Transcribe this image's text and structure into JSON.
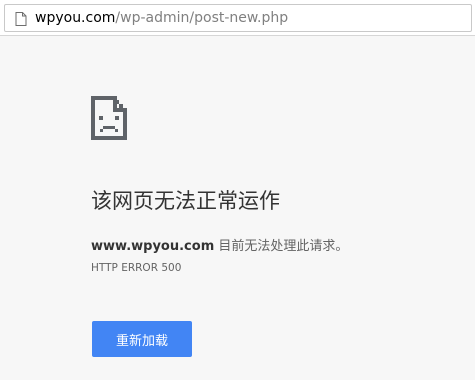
{
  "address_bar": {
    "url_host": "wpyou.com",
    "url_path": "/wp-admin/post-new.php"
  },
  "error": {
    "icon": "sad-page-icon",
    "title": "该网页无法正常运作",
    "domain": "www.wpyou.com",
    "message": " 目前无法处理此请求。",
    "code": "HTTP ERROR 500",
    "reload_label": "重新加载"
  },
  "colors": {
    "accent": "#4285f4",
    "background": "#f7f7f7"
  }
}
